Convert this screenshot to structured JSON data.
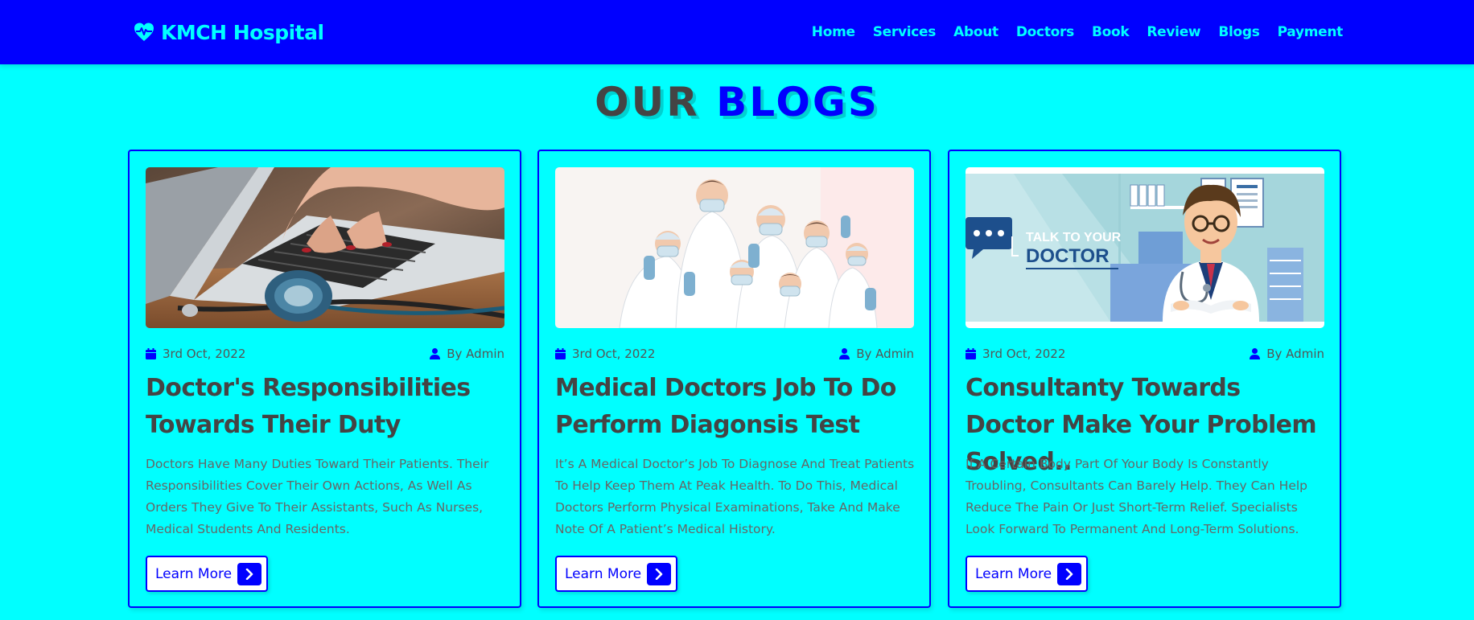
{
  "header": {
    "brand": "KMCH Hospital",
    "logo_icon": "heart-pulse-icon",
    "nav": [
      "Home",
      "Services",
      "About",
      "Doctors",
      "Book",
      "Review",
      "Blogs",
      "Payment"
    ]
  },
  "section": {
    "title_part1": "OUR",
    "title_part2": "BLOGS"
  },
  "blogs": [
    {
      "image": "laptop-stethoscope-photo",
      "date": "3rd Oct, 2022",
      "author": "By Admin",
      "title": "Doctor's Responsibilities Towards Their Duty",
      "description": "Doctors Have Many Duties Toward Their Patients. Their Responsibilities Cover Their Own Actions, As Well As Orders They Give To Their Assistants, Such As Nurses, Medical Students And Residents.",
      "button": "Learn More"
    },
    {
      "image": "medical-team-photo",
      "date": "3rd Oct, 2022",
      "author": "By Admin",
      "title": "Medical Doctors Job To Do Perform Diagonsis Test",
      "description": "It’s A Medical Doctor’s Job To Diagnose And Treat Patients To Help Keep Them At Peak Health. To Do This, Medical Doctors Perform Physical Examinations, Take And Make Note Of A Patient’s Medical History.",
      "button": "Learn More"
    },
    {
      "image": "talk-to-your-doctor-illustration",
      "image_caption_line1": "TALK TO YOUR",
      "image_caption_line2": "DOCTOR",
      "date": "3rd Oct, 2022",
      "author": "By Admin",
      "title": "Consultanty Towards Doctor Make Your Problem Solved..",
      "description": "If A Certain Body Part Of Your Body Is Constantly Troubling, Consultants Can Barely Help. They Can Help Reduce The Pain Or Just Short-Term Relief. Specialists Look Forward To Permanent And Long-Term Solutions.",
      "button": "Learn More"
    }
  ],
  "colors": {
    "background": "#00ffff",
    "primary": "#0000ff",
    "heading_dark": "#444444",
    "text_muted": "#666666"
  }
}
